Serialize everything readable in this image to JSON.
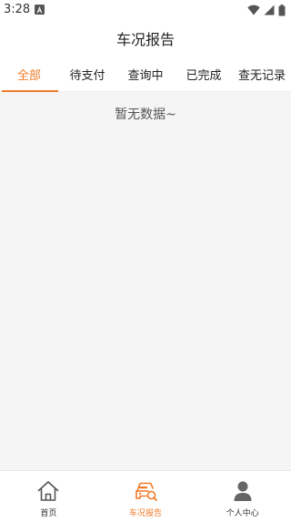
{
  "status_bar": {
    "time": "3:28"
  },
  "header": {
    "title": "车况报告"
  },
  "tabs": [
    {
      "label": "全部",
      "active": true
    },
    {
      "label": "待支付",
      "active": false
    },
    {
      "label": "查询中",
      "active": false
    },
    {
      "label": "已完成",
      "active": false
    },
    {
      "label": "查无记录",
      "active": false
    }
  ],
  "main": {
    "empty_text": "暂无数据~"
  },
  "bottom_nav": {
    "items": [
      {
        "label": "首页",
        "icon": "home-icon",
        "active": false
      },
      {
        "label": "车况报告",
        "icon": "car-report-icon",
        "active": true
      },
      {
        "label": "个人中心",
        "icon": "user-icon",
        "active": false
      }
    ]
  },
  "colors": {
    "accent": "#f07a28",
    "background": "#f5f5f5",
    "text": "#222222"
  }
}
